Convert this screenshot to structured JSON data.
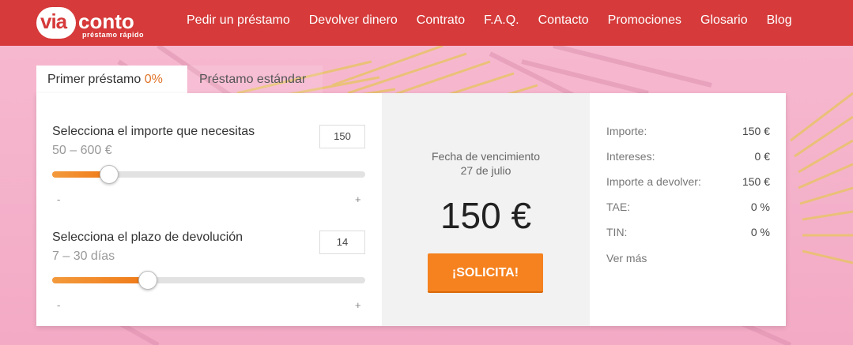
{
  "brand": {
    "logo_via": "via",
    "logo_conto": "conto",
    "logo_tagline": "préstamo rápido",
    "primary_color": "#d63a3a",
    "accent_color": "#f5821f"
  },
  "nav": {
    "items": [
      "Pedir un préstamo",
      "Devolver dinero",
      "Contrato",
      "F.A.Q.",
      "Contacto",
      "Promociones",
      "Glosario",
      "Blog"
    ]
  },
  "tabs": {
    "first_label": "Primer préstamo",
    "first_pct": "0%",
    "standard_label": "Préstamo estándar"
  },
  "amount_slider": {
    "label": "Selecciona el importe que necesitas",
    "range": "50 – 600 €",
    "value": "150",
    "min": 50,
    "max": 600,
    "current": 150,
    "minus": "-",
    "plus": "+"
  },
  "term_slider": {
    "label": "Selecciona el plazo de devolución",
    "range": "7 – 30 días",
    "value": "14",
    "min": 7,
    "max": 30,
    "current": 14,
    "minus": "-",
    "plus": "+"
  },
  "summary": {
    "due_label": "Fecha de vencimiento",
    "due_date": "27 de julio",
    "amount": "150 €",
    "cta_label": "¡SOLICITA!"
  },
  "details": {
    "rows": [
      {
        "label": "Importe:",
        "value": "150 €"
      },
      {
        "label": "Intereses:",
        "value": "0 €"
      },
      {
        "label": "Importe a devolver:",
        "value": "150 €"
      },
      {
        "label": "TAE:",
        "value": "0 %"
      },
      {
        "label": "TIN:",
        "value": "0 %"
      }
    ],
    "more_label": "Ver más"
  }
}
